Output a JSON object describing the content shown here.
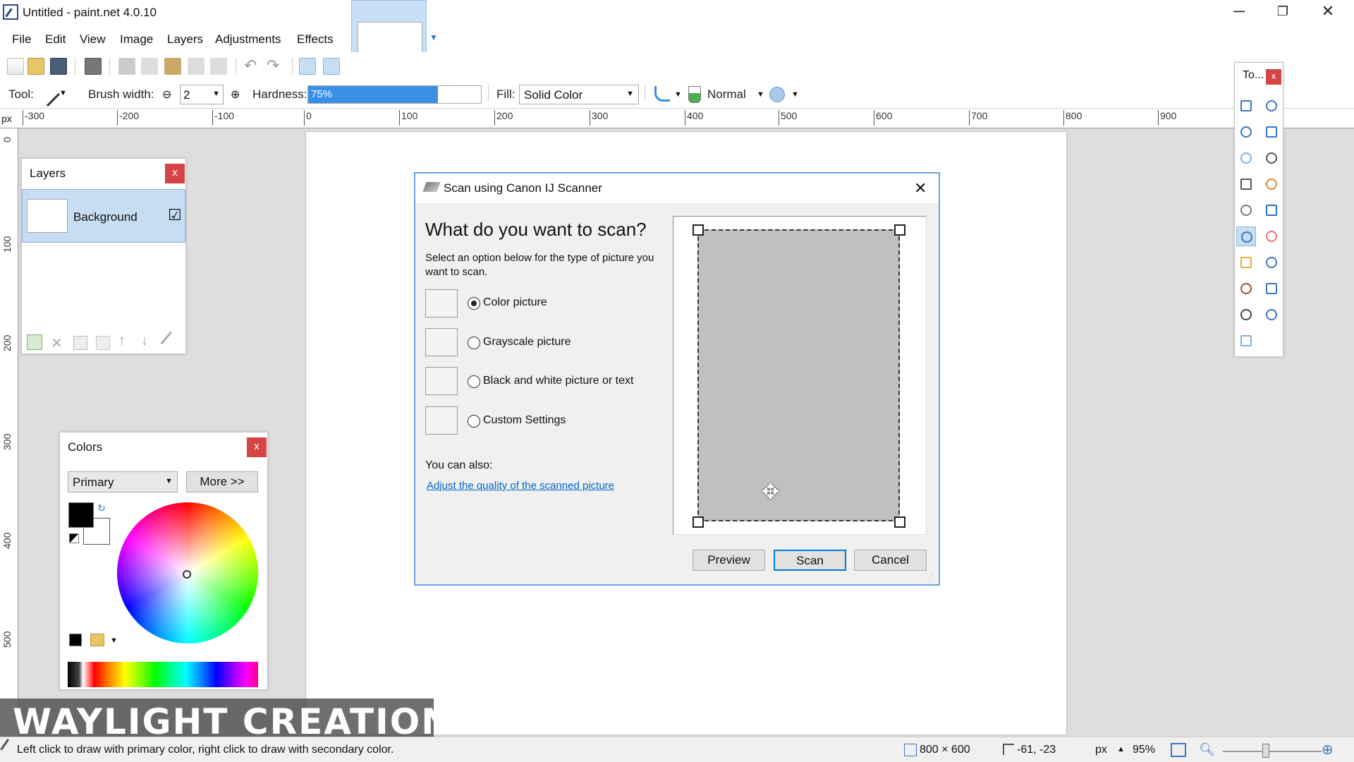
{
  "window": {
    "title": "Untitled - paint.net 4.0.10",
    "minimize": "─",
    "restore": "❐",
    "close": "✕"
  },
  "menu": [
    "File",
    "Edit",
    "View",
    "Image",
    "Layers",
    "Adjustments",
    "Effects"
  ],
  "toolbar_icons": [
    "new-icon",
    "open-icon",
    "save-icon",
    "print-icon",
    "cut-icon",
    "copy-icon",
    "paste-icon",
    "crop-icon",
    "deselect-icon",
    "undo-icon",
    "redo-icon",
    "grid-icon",
    "rulers-icon"
  ],
  "options": {
    "tool_label": "Tool:",
    "brush_width_label": "Brush width:",
    "brush_width_value": "2",
    "hardness_label": "Hardness:",
    "hardness_value": "75%",
    "hardness_fraction": 0.75,
    "fill_label": "Fill:",
    "fill_value": "Solid Color",
    "blend_value": "Normal"
  },
  "ruler": {
    "unit": "px",
    "h_ticks": [
      "-300",
      "-200",
      "-100",
      "0",
      "100",
      "200",
      "300",
      "400",
      "500",
      "600",
      "700",
      "800",
      "900"
    ],
    "v_ticks": [
      "0",
      "100",
      "200",
      "300",
      "400",
      "500"
    ]
  },
  "layers_panel": {
    "title": "Layers",
    "close": "x",
    "layer_name": "Background",
    "checked": "☑"
  },
  "colors_panel": {
    "title": "Colors",
    "close": "x",
    "mode": "Primary",
    "more_button": "More >>"
  },
  "tools_panel": {
    "title": "To...",
    "close": "x"
  },
  "dialog": {
    "title": "Scan using Canon IJ Scanner",
    "close": "✕",
    "heading": "What do you want to scan?",
    "instructions": "Select an option below for the type of picture you want to scan.",
    "options": [
      {
        "label": "Color picture",
        "selected": true
      },
      {
        "label": "Grayscale picture",
        "selected": false
      },
      {
        "label": "Black and white picture or text",
        "selected": false
      },
      {
        "label": "Custom Settings",
        "selected": false
      }
    ],
    "also_label": "You can also:",
    "link": "Adjust the quality of the scanned picture",
    "preview_button": "Preview",
    "scan_button": "Scan",
    "cancel_button": "Cancel"
  },
  "status": {
    "hint": "Left click to draw with primary color, right click to draw with secondary color.",
    "image_size": "800 × 600",
    "cursor_pos": "-61, -23",
    "unit": "px",
    "zoom": "95%"
  },
  "watermark": "WAYLIGHT CREATIONS",
  "colors": {
    "accent": "#3a8ee6",
    "close_red": "#d64545",
    "dialog_border": "#6aa4dc",
    "link": "#0066cc"
  }
}
